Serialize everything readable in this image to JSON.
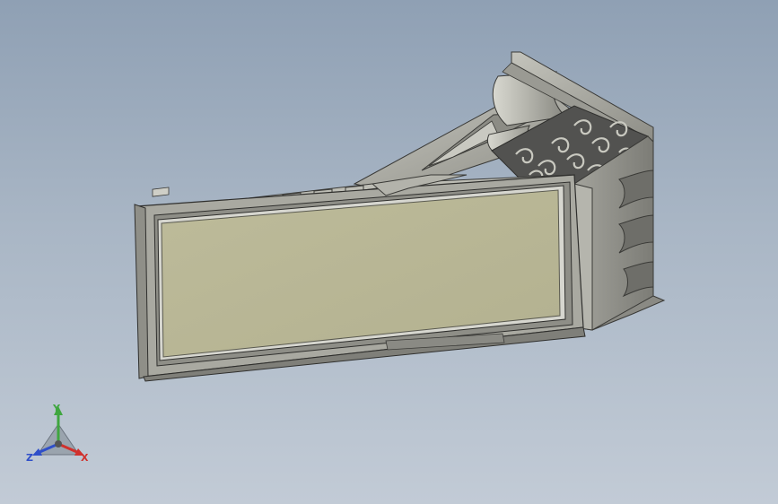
{
  "viewport": {
    "background_top": "#8fa0b4",
    "background_bottom": "#c2cbd6"
  },
  "model": {
    "description_icon": "cad-3d-part",
    "body_color": "#a7a79f",
    "panel_color": "#b9b796",
    "dark_color": "#4b4b48",
    "edge_color": "#2f2f2d"
  },
  "triad": {
    "x_label": "X",
    "y_label": "Y",
    "z_label": "Z",
    "x_color": "#d0312d",
    "y_color": "#3fa63f",
    "z_color": "#2f4fc9"
  }
}
